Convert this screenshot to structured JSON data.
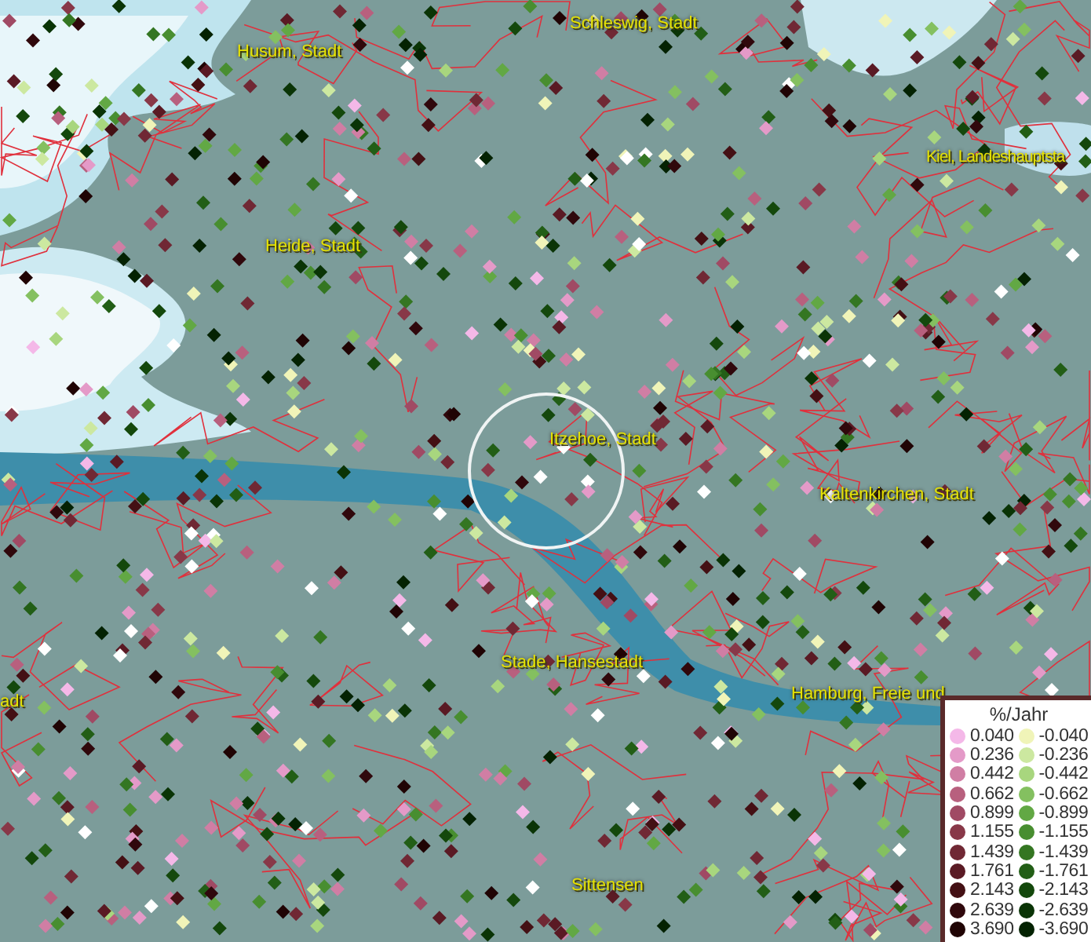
{
  "map": {
    "place_labels": [
      {
        "text": "Schleswig, Stadt"
      },
      {
        "text": "Husum, Stadt"
      },
      {
        "text": "Kiel, Landeshauptsta"
      },
      {
        "text": "Heide, Stadt"
      },
      {
        "text": "Itzehoe, Stadt"
      },
      {
        "text": "Kaltenkirchen, Stadt"
      },
      {
        "text": "Stade, Hansestadt"
      },
      {
        "text": "adt"
      },
      {
        "text": "Hamburg, Freie und"
      },
      {
        "text": "Sittensen"
      }
    ]
  },
  "legend": {
    "title": "%/Jahr",
    "columns": [
      [
        {
          "label": "0.040",
          "color": "#f4b8e8"
        },
        {
          "label": "0.236",
          "color": "#e49ac8"
        },
        {
          "label": "0.442",
          "color": "#d07ea4"
        },
        {
          "label": "0.662",
          "color": "#b8607e"
        },
        {
          "label": "0.899",
          "color": "#a04a64"
        },
        {
          "label": "1.155",
          "color": "#883848"
        },
        {
          "label": "1.439",
          "color": "#702834"
        },
        {
          "label": "1.761",
          "color": "#5a1a24"
        },
        {
          "label": "2.143",
          "color": "#441014"
        },
        {
          "label": "2.639",
          "color": "#30080c"
        },
        {
          "label": "3.690",
          "color": "#200404"
        }
      ],
      [
        {
          "label": "-0.040",
          "color": "#f0f4b8"
        },
        {
          "label": "-0.236",
          "color": "#cce8a0"
        },
        {
          "label": "-0.442",
          "color": "#a8d67e"
        },
        {
          "label": "-0.662",
          "color": "#84c060"
        },
        {
          "label": "-0.899",
          "color": "#62a844"
        },
        {
          "label": "-1.155",
          "color": "#488e30"
        },
        {
          "label": "-1.439",
          "color": "#347622"
        },
        {
          "label": "-1.761",
          "color": "#225e16"
        },
        {
          "label": "-2.143",
          "color": "#14480c"
        },
        {
          "label": "-2.639",
          "color": "#0a3406"
        },
        {
          "label": "-3.690",
          "color": "#042202"
        }
      ]
    ]
  }
}
